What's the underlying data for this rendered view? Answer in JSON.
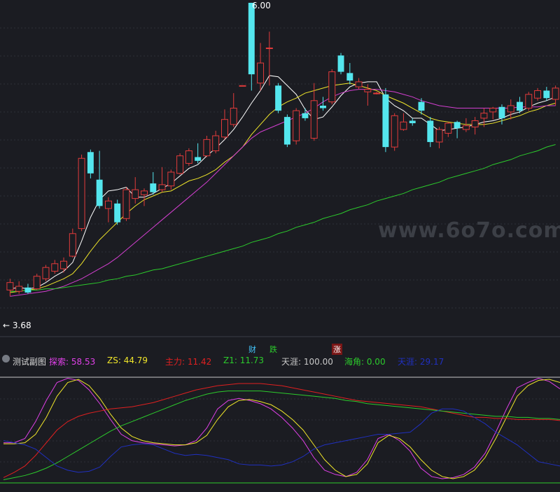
{
  "chart_data": {
    "type": "candlestick",
    "main_panel": {
      "price_high_label": "6.00",
      "price_low_label": "3.68",
      "ylim": [
        3.4,
        6.0
      ],
      "candles": [
        {
          "o": 3.71,
          "c": 3.77,
          "h": 3.8,
          "l": 3.66,
          "up": true
        },
        {
          "o": 3.7,
          "c": 3.74,
          "h": 3.78,
          "l": 3.68,
          "up": true
        },
        {
          "o": 3.73,
          "c": 3.69,
          "h": 3.76,
          "l": 3.68,
          "up": false
        },
        {
          "o": 3.72,
          "c": 3.82,
          "h": 3.84,
          "l": 3.71,
          "up": true
        },
        {
          "o": 3.8,
          "c": 3.89,
          "h": 3.91,
          "l": 3.78,
          "up": true
        },
        {
          "o": 3.86,
          "c": 3.92,
          "h": 3.95,
          "l": 3.84,
          "up": true
        },
        {
          "o": 3.88,
          "c": 3.94,
          "h": 3.97,
          "l": 3.85,
          "up": true
        },
        {
          "o": 3.98,
          "c": 4.16,
          "h": 4.2,
          "l": 3.97,
          "up": true
        },
        {
          "o": 4.2,
          "c": 4.76,
          "h": 4.79,
          "l": 4.18,
          "up": true
        },
        {
          "o": 4.81,
          "c": 4.64,
          "h": 4.83,
          "l": 4.6,
          "up": false
        },
        {
          "o": 4.59,
          "c": 4.38,
          "h": 4.82,
          "l": 4.36,
          "up": false
        },
        {
          "o": 4.36,
          "c": 4.42,
          "h": 4.45,
          "l": 4.25,
          "up": true
        },
        {
          "o": 4.4,
          "c": 4.25,
          "h": 4.43,
          "l": 4.23,
          "up": false
        },
        {
          "o": 4.28,
          "c": 4.51,
          "h": 4.53,
          "l": 4.26,
          "up": true
        },
        {
          "o": 4.44,
          "c": 4.51,
          "h": 4.61,
          "l": 4.4,
          "up": true
        },
        {
          "o": 4.47,
          "c": 4.5,
          "h": 4.52,
          "l": 4.38,
          "up": true
        },
        {
          "o": 4.56,
          "c": 4.49,
          "h": 4.65,
          "l": 4.47,
          "up": false
        },
        {
          "o": 4.51,
          "c": 4.55,
          "h": 4.69,
          "l": 4.49,
          "up": true
        },
        {
          "o": 4.54,
          "c": 4.65,
          "h": 4.67,
          "l": 4.51,
          "up": true
        },
        {
          "o": 4.64,
          "c": 4.78,
          "h": 4.8,
          "l": 4.63,
          "up": true
        },
        {
          "o": 4.72,
          "c": 4.82,
          "h": 4.84,
          "l": 4.7,
          "up": true
        },
        {
          "o": 4.77,
          "c": 4.74,
          "h": 4.88,
          "l": 4.72,
          "up": false
        },
        {
          "o": 4.78,
          "c": 4.91,
          "h": 4.94,
          "l": 4.77,
          "up": true
        },
        {
          "o": 4.82,
          "c": 4.94,
          "h": 4.98,
          "l": 4.8,
          "up": true
        },
        {
          "o": 4.93,
          "c": 5.07,
          "h": 5.15,
          "l": 4.91,
          "up": true
        },
        {
          "o": 5.03,
          "c": 5.16,
          "h": 5.28,
          "l": 5.01,
          "up": true
        },
        {
          "o": 5.34,
          "c": 5.34,
          "h": 5.34,
          "l": 5.34,
          "up": true
        },
        {
          "o": 6.0,
          "c": 5.43,
          "h": 6.0,
          "l": 5.3,
          "up": false
        },
        {
          "o": 5.36,
          "c": 5.52,
          "h": 5.68,
          "l": 5.3,
          "up": true
        },
        {
          "o": 5.64,
          "c": 5.64,
          "h": 5.77,
          "l": 5.34,
          "up": true
        },
        {
          "o": 5.34,
          "c": 5.14,
          "h": 5.36,
          "l": 5.12,
          "up": false
        },
        {
          "o": 5.09,
          "c": 4.87,
          "h": 5.11,
          "l": 4.85,
          "up": false
        },
        {
          "o": 4.9,
          "c": 5.14,
          "h": 5.16,
          "l": 4.87,
          "up": true
        },
        {
          "o": 5.12,
          "c": 5.08,
          "h": 5.16,
          "l": 5.06,
          "up": false
        },
        {
          "o": 4.92,
          "c": 5.22,
          "h": 5.36,
          "l": 4.9,
          "up": true
        },
        {
          "o": 5.16,
          "c": 5.18,
          "h": 5.25,
          "l": 5.14,
          "up": false
        },
        {
          "o": 5.21,
          "c": 5.45,
          "h": 5.47,
          "l": 5.19,
          "up": true
        },
        {
          "o": 5.58,
          "c": 5.45,
          "h": 5.6,
          "l": 5.43,
          "up": false
        },
        {
          "o": 5.44,
          "c": 5.38,
          "h": 5.52,
          "l": 5.35,
          "up": false
        },
        {
          "o": 5.33,
          "c": 5.37,
          "h": 5.4,
          "l": 5.31,
          "up": true
        },
        {
          "o": 5.29,
          "c": 5.31,
          "h": 5.35,
          "l": 5.18,
          "up": true
        },
        {
          "o": 5.28,
          "c": 5.28,
          "h": 5.29,
          "l": 5.27,
          "up": true
        },
        {
          "o": 5.27,
          "c": 4.85,
          "h": 5.32,
          "l": 4.81,
          "up": false
        },
        {
          "o": 4.85,
          "c": 5.1,
          "h": 5.12,
          "l": 4.82,
          "up": true
        },
        {
          "o": 4.99,
          "c": 5.05,
          "h": 5.12,
          "l": 4.98,
          "up": true
        },
        {
          "o": 5.04,
          "c": 5.06,
          "h": 5.08,
          "l": 5.02,
          "up": false
        },
        {
          "o": 5.21,
          "c": 5.14,
          "h": 5.24,
          "l": 5.11,
          "up": false
        },
        {
          "o": 5.06,
          "c": 4.89,
          "h": 5.09,
          "l": 4.85,
          "up": false
        },
        {
          "o": 4.89,
          "c": 4.99,
          "h": 5.01,
          "l": 4.84,
          "up": true
        },
        {
          "o": 4.96,
          "c": 5.04,
          "h": 5.05,
          "l": 4.93,
          "up": true
        },
        {
          "o": 5.05,
          "c": 5.0,
          "h": 5.06,
          "l": 4.92,
          "up": false
        },
        {
          "o": 4.99,
          "c": 5.02,
          "h": 5.08,
          "l": 4.97,
          "up": true
        },
        {
          "o": 5.01,
          "c": 5.06,
          "h": 5.09,
          "l": 4.95,
          "up": true
        },
        {
          "o": 5.08,
          "c": 5.12,
          "h": 5.16,
          "l": 5.01,
          "up": true
        },
        {
          "o": 5.13,
          "c": 5.16,
          "h": 5.17,
          "l": 5.07,
          "up": true
        },
        {
          "o": 5.17,
          "c": 5.08,
          "h": 5.19,
          "l": 5.03,
          "up": false
        },
        {
          "o": 5.13,
          "c": 5.18,
          "h": 5.23,
          "l": 5.07,
          "up": true
        },
        {
          "o": 5.21,
          "c": 5.14,
          "h": 5.25,
          "l": 5.12,
          "up": false
        },
        {
          "o": 5.16,
          "c": 5.27,
          "h": 5.29,
          "l": 5.14,
          "up": true
        },
        {
          "o": 5.24,
          "c": 5.3,
          "h": 5.32,
          "l": 5.22,
          "up": true
        },
        {
          "o": 5.3,
          "c": 5.24,
          "h": 5.33,
          "l": 5.22,
          "up": false
        },
        {
          "o": 5.23,
          "c": 5.32,
          "h": 5.34,
          "l": 5.18,
          "up": true
        }
      ],
      "ma_series": [
        {
          "color": "#ffffff",
          "values": [
            3.72,
            3.73,
            3.72,
            3.73,
            3.77,
            3.82,
            3.86,
            3.93,
            4.1,
            4.29,
            4.43,
            4.5,
            4.51,
            4.53,
            4.45,
            4.45,
            4.48,
            4.52,
            4.56,
            4.62,
            4.68,
            4.71,
            4.78,
            4.84,
            4.91,
            4.99,
            5.09,
            5.2,
            5.3,
            5.42,
            5.41,
            5.34,
            5.27,
            5.15,
            5.07,
            5.09,
            5.17,
            5.26,
            5.33,
            5.36,
            5.37,
            5.37,
            5.24,
            5.18,
            5.14,
            5.08,
            5.08,
            5.03,
            4.98,
            4.99,
            5.0,
            5.01,
            5.03,
            5.05,
            5.06,
            5.08,
            5.11,
            5.13,
            5.17,
            5.2,
            5.22,
            5.25
          ]
        },
        {
          "color": "#f0e62a",
          "values": [
            3.69,
            3.7,
            3.71,
            3.72,
            3.74,
            3.77,
            3.8,
            3.84,
            3.92,
            4.02,
            4.11,
            4.18,
            4.25,
            4.32,
            4.38,
            4.43,
            4.46,
            4.49,
            4.5,
            4.54,
            4.58,
            4.6,
            4.63,
            4.67,
            4.73,
            4.78,
            4.85,
            4.95,
            5.03,
            5.11,
            5.17,
            5.21,
            5.24,
            5.28,
            5.3,
            5.32,
            5.34,
            5.35,
            5.36,
            5.34,
            5.32,
            5.3,
            5.26,
            5.23,
            5.2,
            5.16,
            5.12,
            5.08,
            5.06,
            5.05,
            5.04,
            5.03,
            5.03,
            5.03,
            5.04,
            5.06,
            5.08,
            5.1,
            5.13,
            5.15,
            5.18,
            5.2
          ]
        },
        {
          "color": "#d33fd0",
          "values": [
            3.66,
            3.67,
            3.68,
            3.69,
            3.7,
            3.72,
            3.74,
            3.77,
            3.8,
            3.84,
            3.88,
            3.92,
            3.97,
            4.03,
            4.09,
            4.15,
            4.21,
            4.27,
            4.33,
            4.39,
            4.45,
            4.51,
            4.57,
            4.64,
            4.71,
            4.78,
            4.85,
            4.92,
            4.97,
            5.0,
            5.03,
            5.06,
            5.09,
            5.12,
            5.16,
            5.21,
            5.25,
            5.28,
            5.3,
            5.31,
            5.31,
            5.31,
            5.3,
            5.29,
            5.27,
            5.25,
            5.22,
            5.2,
            5.18,
            5.17,
            5.16,
            5.16,
            5.16,
            5.16,
            5.16,
            5.16,
            5.16,
            5.17,
            5.17,
            5.17,
            5.18,
            5.18
          ]
        },
        {
          "color": "#2ccb2c",
          "values": [
            3.7,
            3.7,
            3.71,
            3.71,
            3.72,
            3.72,
            3.73,
            3.74,
            3.75,
            3.76,
            3.77,
            3.79,
            3.8,
            3.82,
            3.83,
            3.85,
            3.87,
            3.88,
            3.9,
            3.92,
            3.94,
            3.96,
            3.98,
            4.0,
            4.02,
            4.04,
            4.06,
            4.09,
            4.11,
            4.13,
            4.16,
            4.18,
            4.21,
            4.23,
            4.25,
            4.28,
            4.3,
            4.32,
            4.35,
            4.37,
            4.39,
            4.42,
            4.44,
            4.46,
            4.48,
            4.51,
            4.53,
            4.55,
            4.57,
            4.6,
            4.62,
            4.64,
            4.66,
            4.68,
            4.71,
            4.73,
            4.75,
            4.78,
            4.8,
            4.82,
            4.85,
            4.87
          ]
        }
      ],
      "markers": {
        "cai": "财",
        "die": "跌",
        "zhang": "涨"
      }
    },
    "sub_panel": {
      "title": "测试副图",
      "ylim": [
        0,
        100
      ],
      "reference_lines": [
        {
          "value": 100,
          "color": "#c8c8c8"
        },
        {
          "value": 0,
          "color": "#2ccb2c"
        }
      ],
      "legend": [
        {
          "label": "探索:",
          "value": "58.53",
          "color": "#e040e8"
        },
        {
          "label": "ZS:",
          "value": "44.79",
          "color": "#f0e62a"
        },
        {
          "label": "主力:",
          "value": "11.42",
          "color": "#e02020"
        },
        {
          "label": "Z1:",
          "value": "11.73",
          "color": "#2ccb2c"
        },
        {
          "label": "天涯:",
          "value": "100.00",
          "color": "#c8c8c8"
        },
        {
          "label": "海角:",
          "value": "0.00",
          "color": "#2ccb2c"
        },
        {
          "label": "天涯:",
          "value": "29.17",
          "color": "#2030c0"
        }
      ],
      "series": [
        {
          "color": "#e040e8",
          "values": [
            38,
            38,
            42,
            58,
            78,
            95,
            99,
            97,
            88,
            75,
            60,
            46,
            40,
            38,
            37,
            36,
            35,
            36,
            40,
            52,
            70,
            78,
            80,
            78,
            75,
            70,
            62,
            52,
            40,
            24,
            12,
            8,
            6,
            10,
            22,
            42,
            46,
            40,
            30,
            14,
            6,
            4,
            5,
            8,
            15,
            28,
            48,
            70,
            90,
            95,
            99,
            96,
            89
          ]
        },
        {
          "color": "#f0e62a",
          "values": [
            37,
            37,
            38,
            46,
            62,
            82,
            95,
            98,
            92,
            80,
            65,
            52,
            44,
            40,
            38,
            37,
            36,
            36,
            38,
            45,
            60,
            72,
            78,
            79,
            77,
            74,
            68,
            60,
            50,
            36,
            22,
            12,
            6,
            8,
            18,
            38,
            45,
            42,
            34,
            22,
            12,
            6,
            4,
            6,
            12,
            24,
            42,
            62,
            82,
            92,
            97,
            98,
            95
          ]
        },
        {
          "color": "#e02020",
          "values": [
            5,
            10,
            16,
            26,
            38,
            50,
            58,
            63,
            66,
            68,
            70,
            71,
            72,
            74,
            76,
            79,
            82,
            85,
            88,
            90,
            92,
            93,
            94,
            94,
            94,
            93,
            92,
            90,
            88,
            86,
            84,
            82,
            80,
            78,
            77,
            76,
            75,
            74,
            73,
            72,
            70,
            68,
            66,
            64,
            62,
            62,
            61,
            61,
            60,
            60,
            60,
            60,
            59
          ]
        },
        {
          "color": "#2ccb2c",
          "values": [
            3,
            5,
            7,
            10,
            14,
            19,
            25,
            31,
            37,
            43,
            49,
            54,
            58,
            62,
            66,
            70,
            74,
            78,
            81,
            84,
            86,
            87,
            87,
            87,
            87,
            86,
            85,
            84,
            83,
            82,
            81,
            80,
            78,
            77,
            75,
            74,
            73,
            72,
            71,
            70,
            69,
            68,
            67,
            66,
            65,
            64,
            63,
            63,
            62,
            62,
            61,
            61,
            60
          ]
        },
        {
          "color": "#2030c0",
          "values": [
            40,
            38,
            36,
            32,
            24,
            16,
            12,
            10,
            11,
            15,
            25,
            34,
            36,
            37,
            36,
            32,
            28,
            26,
            27,
            26,
            24,
            22,
            18,
            17,
            17,
            16,
            17,
            20,
            25,
            32,
            36,
            38,
            40,
            42,
            44,
            46,
            46,
            47,
            48,
            56,
            66,
            70,
            70,
            68,
            62,
            56,
            48,
            42,
            36,
            28,
            20,
            18,
            16
          ]
        }
      ]
    }
  },
  "watermark": "www.6o7o.com"
}
